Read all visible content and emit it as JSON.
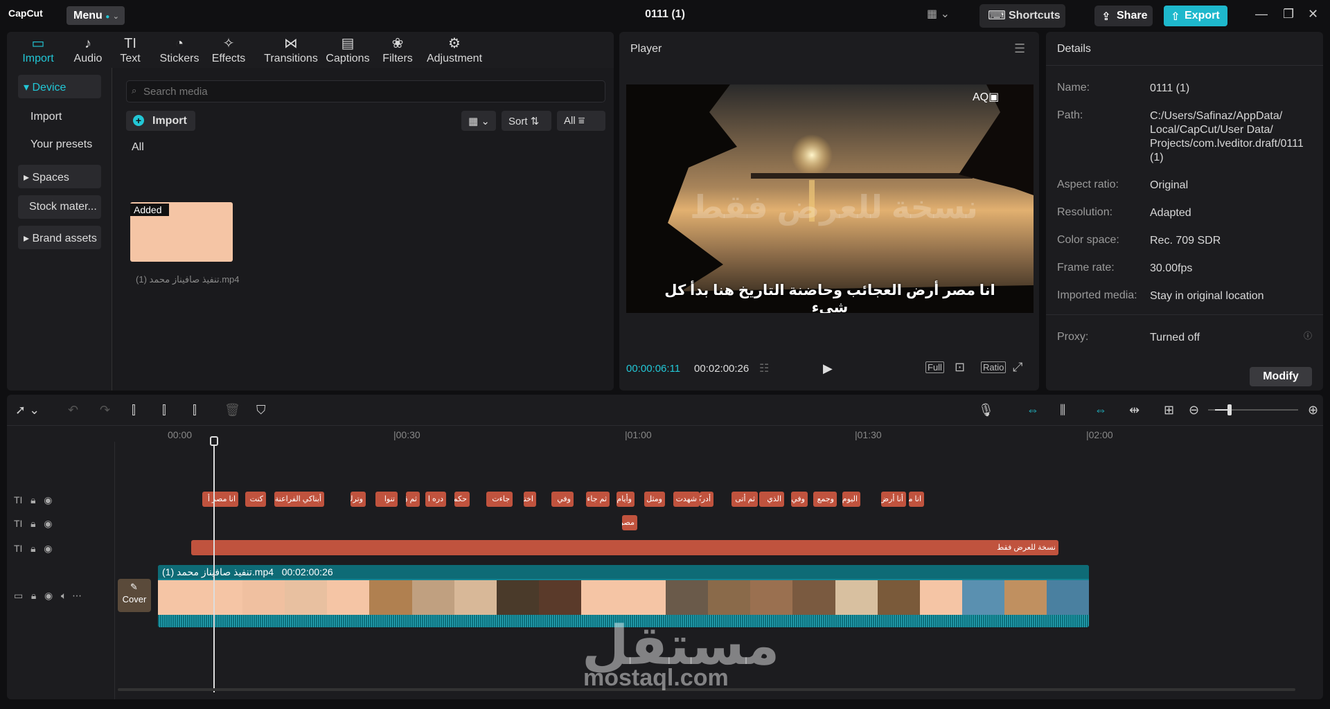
{
  "titlebar": {
    "logo": "CapCut",
    "menu": "Menu",
    "project_title": "0111 (1)",
    "shortcuts": "Shortcuts",
    "share": "Share",
    "export": "Export"
  },
  "left_tabs": [
    {
      "label": "Import",
      "icon": "▭"
    },
    {
      "label": "Audio",
      "icon": "♪"
    },
    {
      "label": "Text",
      "icon": "TI"
    },
    {
      "label": "Stickers",
      "icon": "◔"
    },
    {
      "label": "Effects",
      "icon": "✧"
    },
    {
      "label": "Transitions",
      "icon": "⋈"
    },
    {
      "label": "Captions",
      "icon": "▤"
    },
    {
      "label": "Filters",
      "icon": "❀"
    },
    {
      "label": "Adjustment",
      "icon": "⚙"
    }
  ],
  "sidebar": {
    "device": "Device",
    "import": "Import",
    "presets": "Your presets",
    "spaces": "Spaces",
    "stock": "Stock mater...",
    "brand": "Brand assets"
  },
  "media": {
    "search_placeholder": "Search media",
    "import_btn": "Import",
    "sort": "Sort",
    "all_filter": "All",
    "all_label": "All",
    "added": "Added",
    "clip_name": "تنفيذ صافيناز محمد (1).mp4"
  },
  "player": {
    "title": "Player",
    "watermark_text": "نسخة    للعرض فقط",
    "subtitle": "انا مصر أرض العجائب وحاضنة التاريخ هنا بدأ كل شيء",
    "current_time": "00:00:06:11",
    "total_time": "00:02:00:26",
    "full": "Full",
    "ratio": "Ratio"
  },
  "details": {
    "title": "Details",
    "rows": [
      {
        "key": "Name:",
        "value": "0111 (1)"
      },
      {
        "key": "Path:",
        "value": "C:/Users/Safinaz/AppData/ Local/CapCut/User Data/ Projects/com.lveditor.draft/0111 (1)"
      },
      {
        "key": "Aspect ratio:",
        "value": "Original"
      },
      {
        "key": "Resolution:",
        "value": "Adapted"
      },
      {
        "key": "Color space:",
        "value": "Rec. 709 SDR"
      },
      {
        "key": "Frame rate:",
        "value": "30.00fps"
      },
      {
        "key": "Imported media:",
        "value": "Stay in original location"
      },
      {
        "key": "Proxy:",
        "value": "Turned off"
      }
    ],
    "modify": "Modify"
  },
  "timeline": {
    "ruler": [
      "00:00",
      "|00:30",
      "|01:00",
      "|01:30",
      "|02:00"
    ],
    "text_clips_row1": [
      "انا مصر أ",
      "كنت",
      "أبناكي الفراعنة",
      "وترك",
      "تنوا",
      "ثم ق",
      "دره ا",
      "حكمت",
      "جاءت",
      "اختصر",
      "وفي",
      "ثم جاء المم",
      "وأيام المم",
      "ومثل",
      "شهدت",
      "أدركه",
      "ثم أتى",
      "الذي",
      "وفي",
      "وجمع",
      "اليوم أنا",
      "أنا أرض",
      "انا مصر"
    ],
    "text_clip_row2": "مصر",
    "text_clip_row3": "نسخة للعرض فقط",
    "video_clip_name": "تنفيذ صافيناز محمد (1).mp4",
    "video_clip_duration": "00:02:00:26",
    "cover": "Cover"
  },
  "watermark": {
    "arabic": "مستقل",
    "latin": "mostaql.com"
  }
}
